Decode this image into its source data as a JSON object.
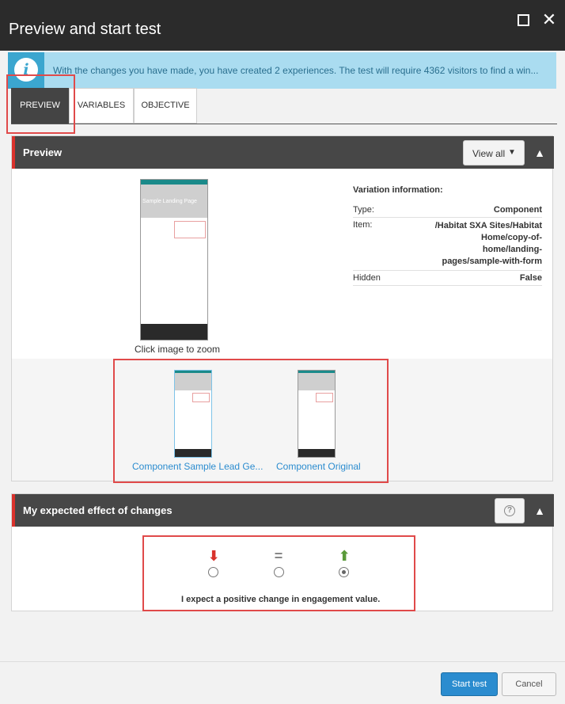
{
  "window": {
    "title": "Preview and start test",
    "maximize_icon": "maximize-icon",
    "close_icon": "close-icon"
  },
  "info": {
    "icon": "info-icon",
    "icon_glyph": "i",
    "message": "With the changes you have made, you have created 2 experiences. The test will require 4362 visitors to find a win..."
  },
  "tabs": [
    {
      "label": "PREVIEW",
      "active": true
    },
    {
      "label": "VARIABLES",
      "active": false
    },
    {
      "label": "OBJECTIVE",
      "active": false
    }
  ],
  "preview_panel": {
    "title": "Preview",
    "view_all_label": "View all",
    "zoom_caption": "Click image to zoom",
    "thumbnail_hero_text": "Sample Landing Page",
    "variation_info": {
      "heading": "Variation information:",
      "rows": [
        {
          "key": "Type:",
          "value": "Component"
        },
        {
          "key": "Item:",
          "value": "/Habitat SXA Sites/Habitat Home/copy-of-home/landing-pages/sample-with-form"
        },
        {
          "key": "Hidden",
          "value": "False"
        }
      ]
    },
    "variants": [
      {
        "caption": "Component Sample Lead Ge..."
      },
      {
        "caption": "Component Original"
      }
    ]
  },
  "effect_panel": {
    "title": "My expected effect of changes",
    "help_icon": "help-icon",
    "help_glyph": "?",
    "options": [
      {
        "icon": "arrow-down-icon",
        "glyph": "⬇",
        "color": "#d9322c",
        "checked": false
      },
      {
        "icon": "equals-icon",
        "glyph": "=",
        "color": "#888888",
        "checked": false
      },
      {
        "icon": "arrow-up-icon",
        "glyph": "⬆",
        "color": "#5a9a3a",
        "checked": true
      }
    ],
    "expectation_text": "I expect a positive change in engagement value."
  },
  "footer": {
    "start_label": "Start test",
    "cancel_label": "Cancel"
  },
  "colors": {
    "accent": "#2b8ccf",
    "title_bar": "#2b2b2b",
    "panel_header": "#474747",
    "panel_marker": "#d9322c",
    "info_bg": "#aadcf0",
    "highlight_box": "#e04a4a"
  }
}
